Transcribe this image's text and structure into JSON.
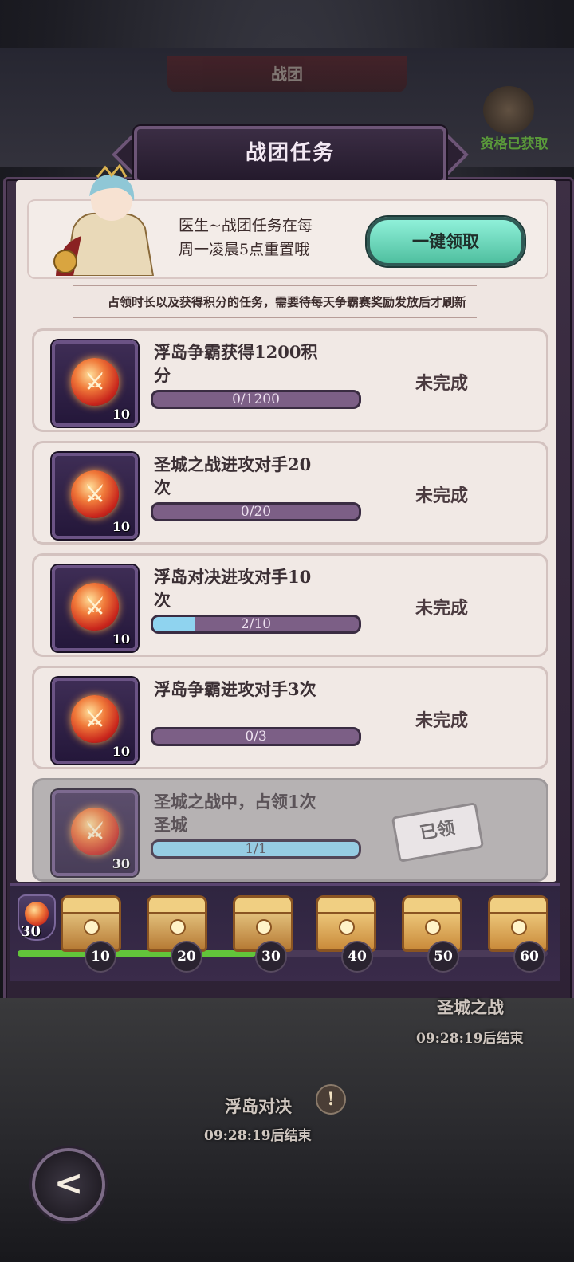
{
  "header": {
    "banner_title": "战团",
    "qualification_text": "资格已获取"
  },
  "panel": {
    "title": "战团任务"
  },
  "info": {
    "message_line1": "医生~战团任务在每",
    "message_line2": "周一凌晨5点重置哦",
    "claim_all_label": "一键领取",
    "notice": "占领时长以及获得积分的任务，需要待每天争霸赛奖励发放后才刷新"
  },
  "tasks": [
    {
      "title_line1": "浮岛争霸获得1200积",
      "title_line2": "分",
      "progress_text": "0/1200",
      "progress": 0,
      "status": "未完成",
      "reward_qty": "10"
    },
    {
      "title_line1": "圣城之战进攻对手20",
      "title_line2": "次",
      "progress_text": "0/20",
      "progress": 0,
      "status": "未完成",
      "reward_qty": "10"
    },
    {
      "title_line1": "浮岛对决进攻对手10",
      "title_line2": "次",
      "progress_text": "2/10",
      "progress": 0.2,
      "status": "未完成",
      "reward_qty": "10"
    },
    {
      "title_line1": "浮岛争霸进攻对手3次",
      "title_line2": "",
      "progress_text": "0/3",
      "progress": 0,
      "status": "未完成",
      "reward_qty": "10"
    },
    {
      "title_line1": "圣城之战中，占领1次",
      "title_line2": "圣城",
      "progress_text": "1/1",
      "progress": 1,
      "status": "已领",
      "reward_qty": "30"
    }
  ],
  "rewards": {
    "current_points": "30",
    "progress": 0.45,
    "chests": [
      {
        "threshold": "10",
        "opened": true
      },
      {
        "threshold": "20",
        "opened": true
      },
      {
        "threshold": "30",
        "opened": true
      },
      {
        "threshold": "40",
        "opened": false
      },
      {
        "threshold": "50",
        "opened": false
      },
      {
        "threshold": "60",
        "opened": false
      }
    ]
  },
  "map": {
    "holy_city_label": "圣城之战",
    "holy_city_timer": "09:28:19后结束",
    "floating_island_label": "浮岛对决",
    "floating_island_timer": "09:28:19后结束",
    "alert_glyph": "!"
  },
  "icons": {
    "back": "back-arrow-icon",
    "task_reward": "guild-medal-icon"
  },
  "colors": {
    "claim_button": "#6fdcc1",
    "progress_fill": "#8fd3ef",
    "reward_progress": "#62c43a",
    "panel_bg": "#efe6e2"
  }
}
